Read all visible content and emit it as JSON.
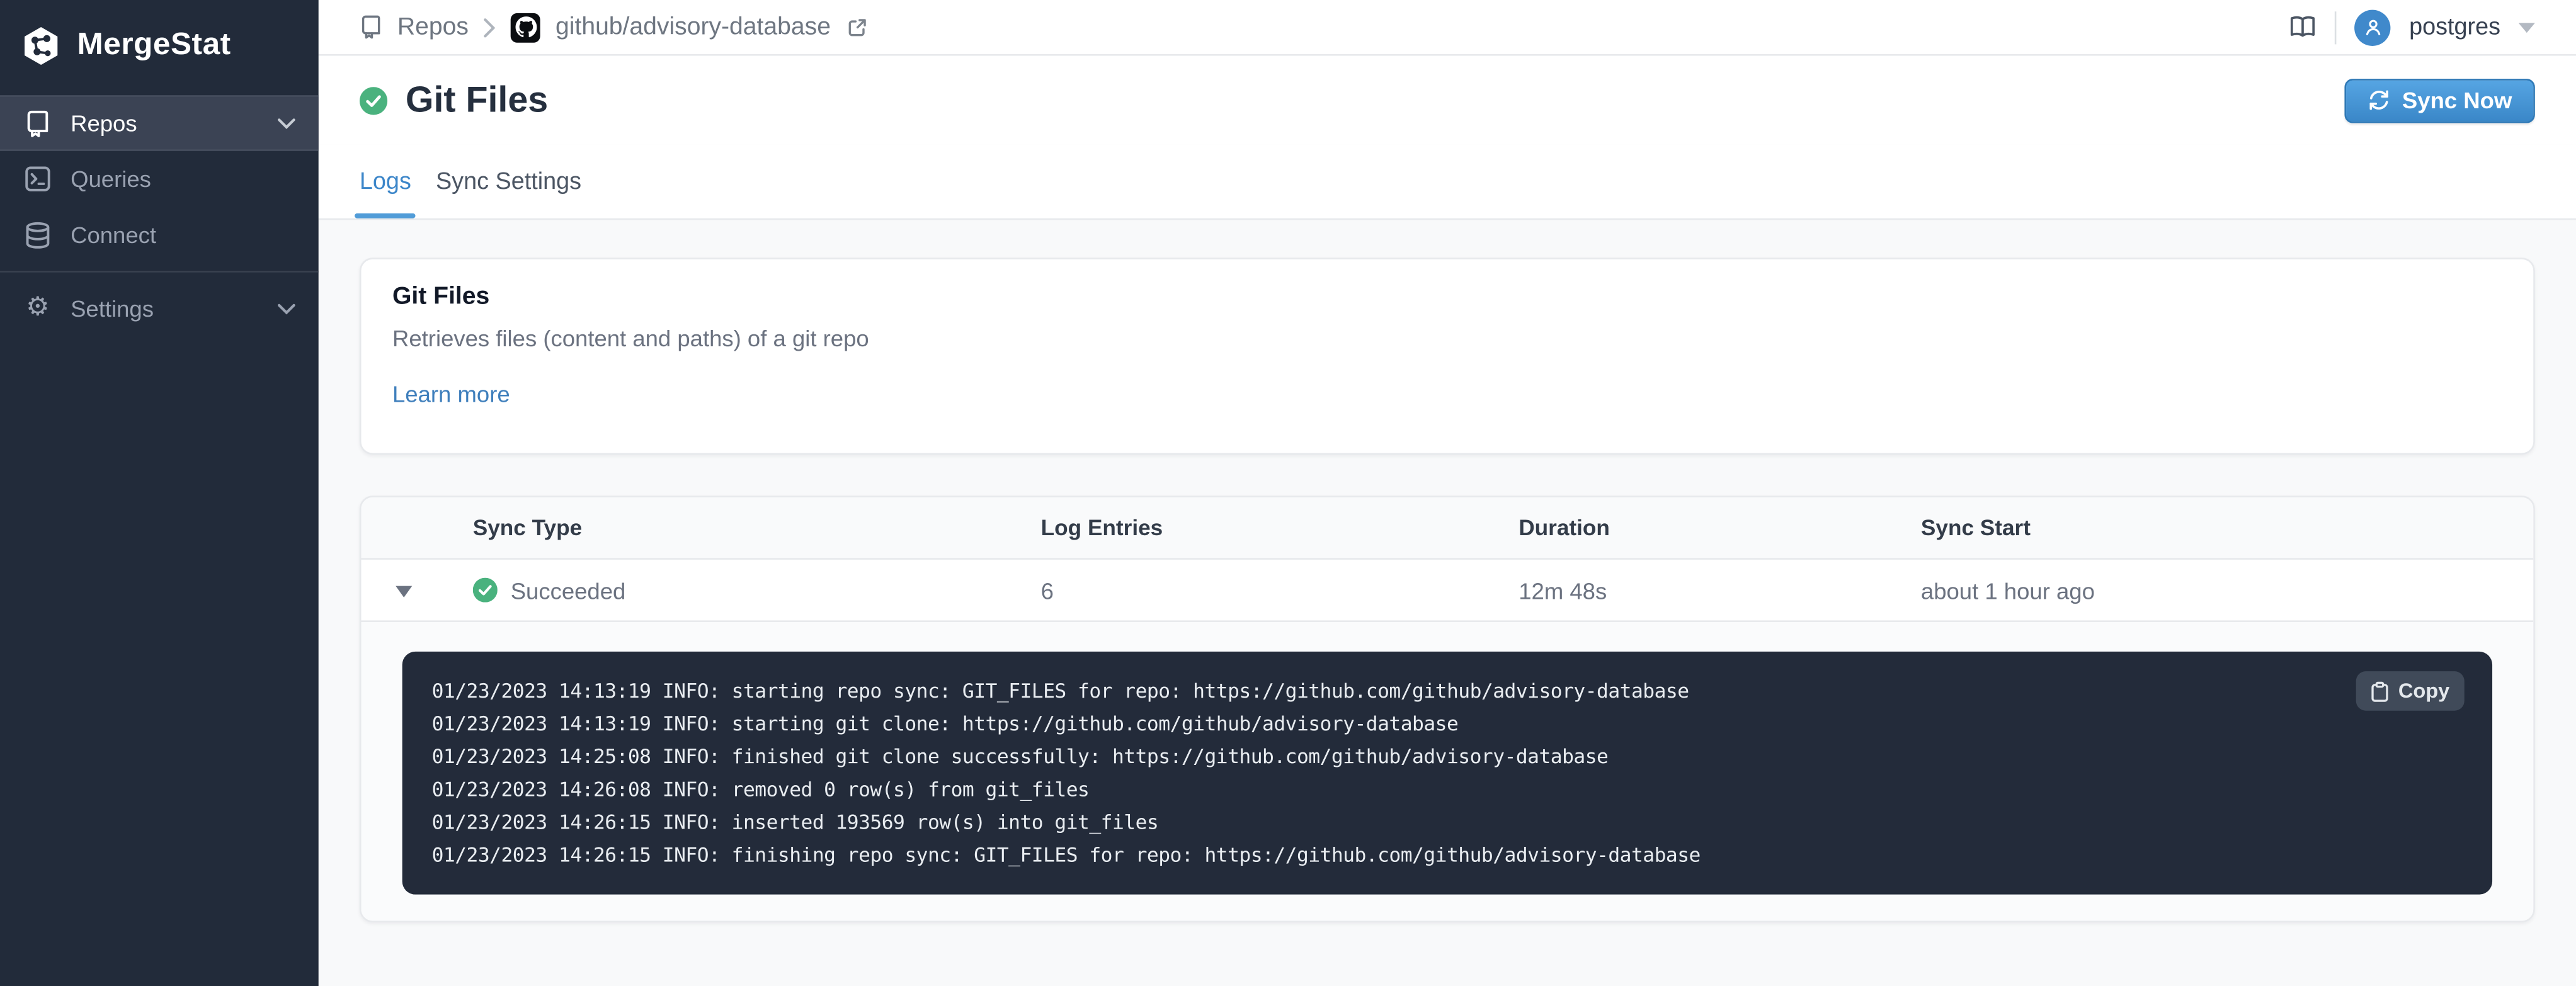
{
  "brand": {
    "name": "MergeStat"
  },
  "sidebar": {
    "items": [
      {
        "label": "Repos"
      },
      {
        "label": "Queries"
      },
      {
        "label": "Connect"
      },
      {
        "label": "Settings"
      }
    ]
  },
  "topbar": {
    "breadcrumb": {
      "section": "Repos",
      "repo": "github/advisory-database"
    },
    "user": {
      "name": "postgres"
    }
  },
  "page": {
    "title": "Git Files",
    "sync_button_label": "Sync Now",
    "tabs": [
      {
        "label": "Logs"
      },
      {
        "label": "Sync Settings"
      }
    ]
  },
  "info_card": {
    "title": "Git Files",
    "description": "Retrieves files (content and paths) of a git repo",
    "link_label": "Learn more"
  },
  "log_table": {
    "columns": [
      "Sync Type",
      "Log Entries",
      "Duration",
      "Sync Start"
    ],
    "rows": [
      {
        "status": "Succeeded",
        "log_entries": "6",
        "duration": "12m 48s",
        "sync_start": "about 1 hour ago"
      }
    ]
  },
  "log_panel": {
    "copy_label": "Copy",
    "lines": [
      "01/23/2023 14:13:19 INFO: starting repo sync: GIT_FILES for repo: https://github.com/github/advisory-database",
      "01/23/2023 14:13:19 INFO: starting git clone: https://github.com/github/advisory-database",
      "01/23/2023 14:25:08 INFO: finished git clone successfully: https://github.com/github/advisory-database",
      "01/23/2023 14:26:08 INFO: removed 0 row(s) from git_files",
      "01/23/2023 14:26:15 INFO: inserted 193569 row(s) into git_files",
      "01/23/2023 14:26:15 INFO: finishing repo sync: GIT_FILES for repo: https://github.com/github/advisory-database"
    ]
  },
  "colors": {
    "sidebar_bg": "#222b3a",
    "log_panel_bg": "#232b3a",
    "accent_blue": "#3c86c9",
    "success_green": "#4ab27e",
    "page_bg": "#f8f9fa"
  }
}
